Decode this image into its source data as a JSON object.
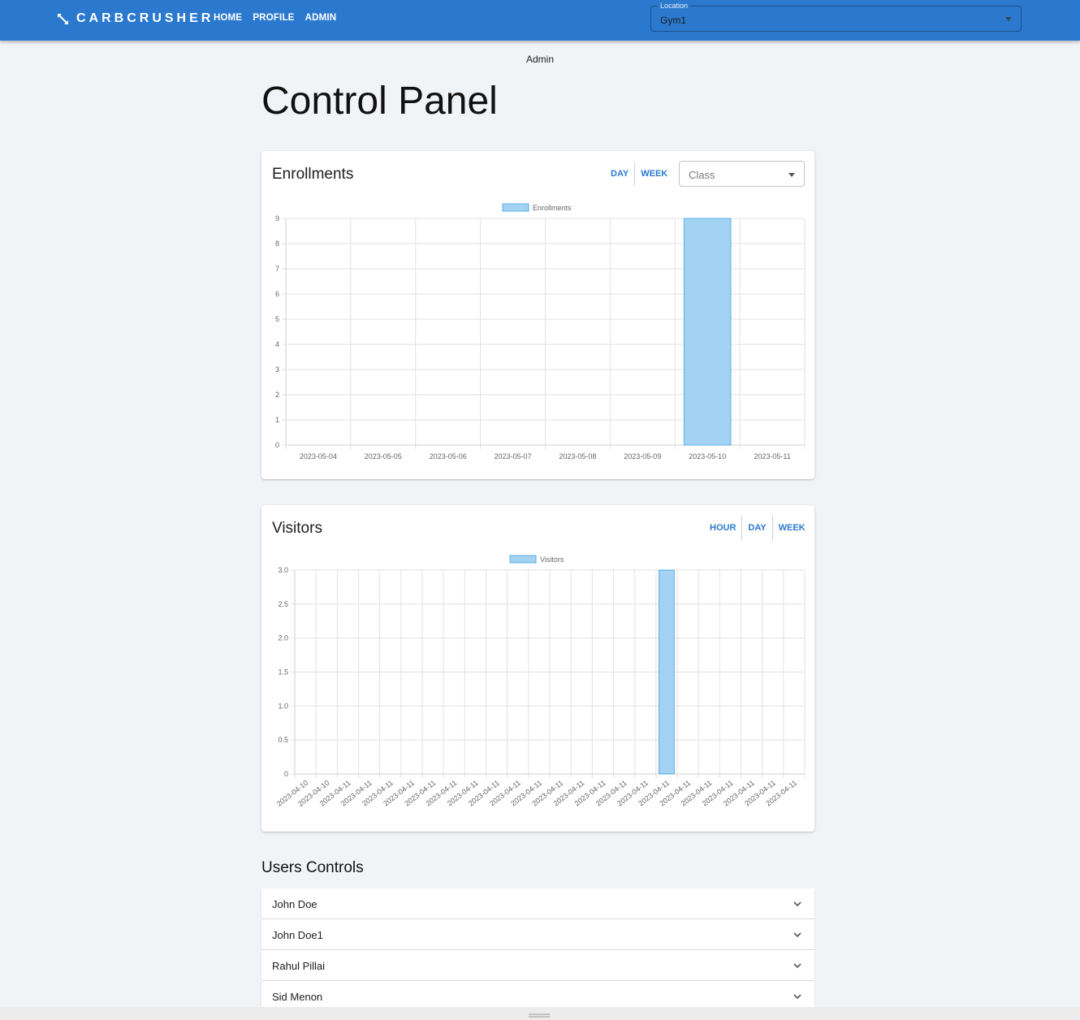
{
  "app": {
    "brand": "CARBCRUSHER"
  },
  "nav": {
    "items": [
      "HOME",
      "PROFILE",
      "ADMIN"
    ]
  },
  "location": {
    "label": "Location",
    "value": "Gym1"
  },
  "breadcrumb": "Admin",
  "page_title": "Control Panel",
  "enrollments": {
    "title": "Enrollments",
    "toggles": [
      "DAY",
      "WEEK"
    ],
    "class_select": {
      "placeholder": "Class"
    }
  },
  "visitors": {
    "title": "Visitors",
    "toggles": [
      "HOUR",
      "DAY",
      "WEEK"
    ]
  },
  "users_controls": {
    "title": "Users Controls",
    "users": [
      "John Doe",
      "John Doe1",
      "Rahul Pillai",
      "Sid Menon"
    ]
  },
  "colors": {
    "appbar": "#2b79cf",
    "bar_fill": "#a3d2f2",
    "bar_stroke": "#5aaee6",
    "accent": "#2b79cf"
  },
  "icons": {
    "brand": "arrows-expand-icon",
    "select_caret": "caret-down-icon",
    "row": "chevron-down-icon"
  },
  "chart_data": [
    {
      "type": "bar",
      "series": [
        {
          "name": "Enrollments",
          "values": [
            0,
            0,
            0,
            0,
            0,
            0,
            9,
            0
          ]
        }
      ],
      "categories": [
        "2023-05-04",
        "2023-05-05",
        "2023-05-06",
        "2023-05-07",
        "2023-05-08",
        "2023-05-09",
        "2023-05-10",
        "2023-05-11"
      ],
      "ylim": [
        0,
        9
      ],
      "yticks": [
        "0",
        "1",
        "2",
        "3",
        "4",
        "5",
        "6",
        "7",
        "8",
        "9"
      ],
      "legend": "top",
      "grid": true
    },
    {
      "type": "bar",
      "series": [
        {
          "name": "Visitors",
          "values": [
            0,
            0,
            0,
            0,
            0,
            0,
            0,
            0,
            0,
            0,
            0,
            0,
            0,
            0,
            0,
            0,
            0,
            3,
            0,
            0,
            0,
            0,
            0,
            0
          ]
        }
      ],
      "categories": [
        "2023-04-10",
        "2023-04-10",
        "2023-04-11",
        "2023-04-11",
        "2023-04-11",
        "2023-04-11",
        "2023-04-11",
        "2023-04-11",
        "2023-04-11",
        "2023-04-11",
        "2023-04-11",
        "2023-04-11",
        "2023-04-11",
        "2023-04-11",
        "2023-04-11",
        "2023-04-11",
        "2023-04-11",
        "2023-04-11",
        "2023-04-11",
        "2023-04-11",
        "2023-04-11",
        "2023-04-11",
        "2023-04-11",
        "2023-04-11"
      ],
      "ylim": [
        0,
        3
      ],
      "yticks": [
        "0",
        "0.5",
        "1.0",
        "1.5",
        "2.0",
        "2.5",
        "3.0"
      ],
      "legend": "top",
      "grid": true
    }
  ]
}
